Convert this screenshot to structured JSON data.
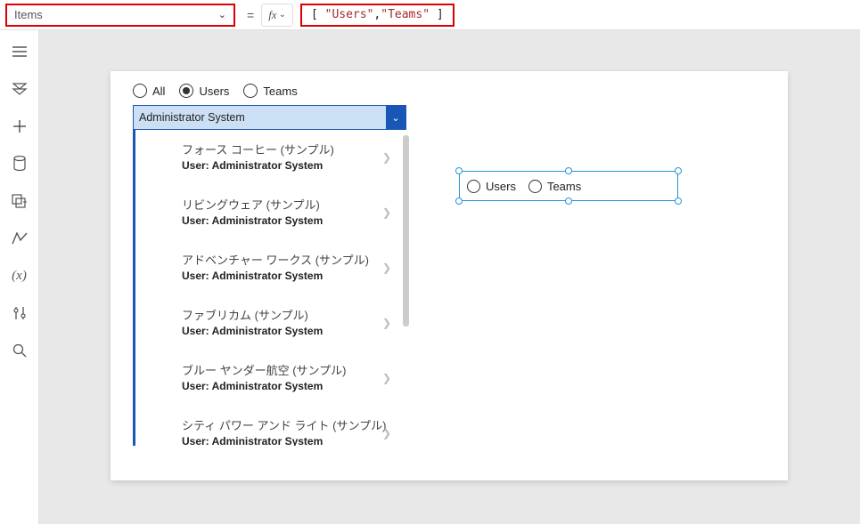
{
  "topbar": {
    "property": "Items",
    "equals": "=",
    "fx": "fx",
    "formula_open": "[",
    "formula_close": "]",
    "formula_s1": "\"Users\"",
    "formula_comma": ", ",
    "formula_s2": "\"Teams\""
  },
  "canvas": {
    "radios": {
      "all": "All",
      "users": "Users",
      "teams": "Teams"
    },
    "combo_value": "Administrator System",
    "list": [
      {
        "title": "フォース コーヒー (サンプル)",
        "sub": "User: Administrator System"
      },
      {
        "title": "リビングウェア (サンプル)",
        "sub": "User: Administrator System"
      },
      {
        "title": "アドベンチャー ワークス (サンプル)",
        "sub": "User: Administrator System"
      },
      {
        "title": "ファブリカム (サンプル)",
        "sub": "User: Administrator System"
      },
      {
        "title": "ブルー ヤンダー航空 (サンプル)",
        "sub": "User: Administrator System"
      },
      {
        "title": "シティ パワー アンド ライト (サンプル)",
        "sub": "User: Administrator System"
      }
    ],
    "selected_radio": {
      "users": "Users",
      "teams": "Teams"
    }
  }
}
